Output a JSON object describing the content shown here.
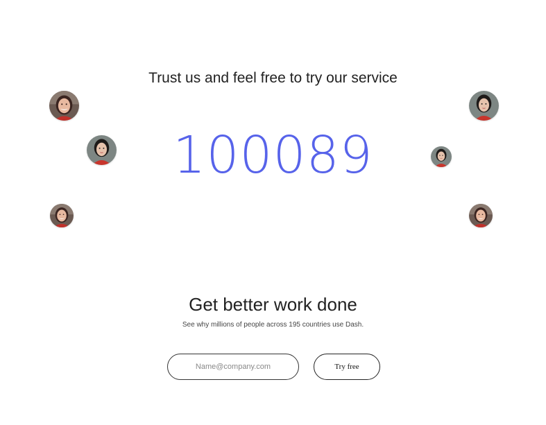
{
  "hero": {
    "heading": "Trust us and feel free to try our service",
    "counter": "100089"
  },
  "avatars": [
    {
      "name": "avatar-smiling-woman",
      "icon": "person-photo-icon"
    },
    {
      "name": "avatar-woman-red-dress",
      "icon": "person-photo-icon"
    }
  ],
  "cta": {
    "heading": "Get better work done",
    "subtitle": "See why millions of people across 195 countries use Dash.",
    "email_placeholder": "Name@company.com",
    "button_label": "Try free"
  },
  "colors": {
    "accent": "#5763ea",
    "text": "#222222",
    "background": "#ffffff"
  }
}
